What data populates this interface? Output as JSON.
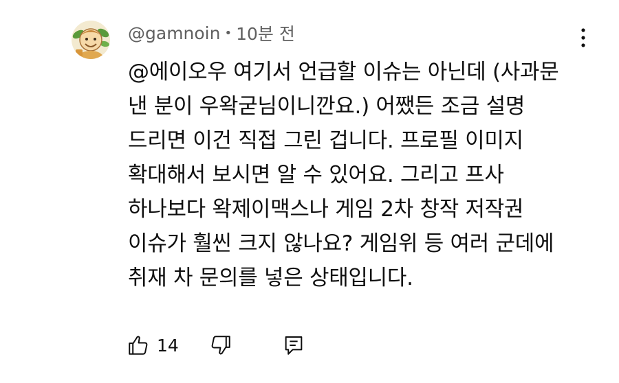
{
  "comment": {
    "author": "@gamnoin",
    "separator": "•",
    "timestamp": "10분 전",
    "lines": [
      "@에이오우 여기서 언급할 이슈는 아닌데 (사과문",
      "낸 분이 우왁굳님이니깐요.) 어쨌든 조금 설명",
      "드리면 이건 직접 그린 겁니다. 프로필 이미지",
      "확대해서 보시면 알 수 있어요. 그리고 프사",
      "하나보다 왁제이맥스나 게임 2차 창작 저작권",
      "이슈가 훨씬 크지 않나요? 게임위 등 여러 군데에",
      "취재 차 문의를 넣은 상태입니다."
    ],
    "like_count": "14"
  },
  "icons": {
    "avatar": "avatar-cartoon-character",
    "more": "more-vert-icon",
    "like": "thumb-up-icon",
    "dislike": "thumb-down-icon",
    "reply": "reply-comment-icon"
  },
  "colors": {
    "text": "#0f0f0f",
    "secondary_text": "#606060",
    "background": "#ffffff"
  }
}
